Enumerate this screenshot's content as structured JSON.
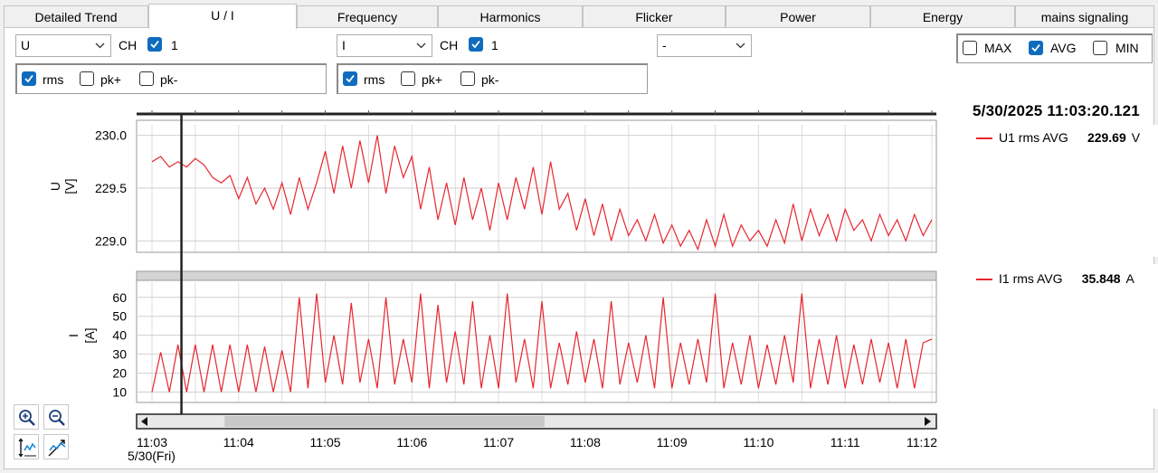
{
  "tabs": [
    {
      "label": "Detailed Trend",
      "active": false
    },
    {
      "label": "U / I",
      "active": true
    },
    {
      "label": "Frequency",
      "active": false
    },
    {
      "label": "Harmonics",
      "active": false
    },
    {
      "label": "Flicker",
      "active": false
    },
    {
      "label": "Power",
      "active": false
    },
    {
      "label": "Energy",
      "active": false
    },
    {
      "label": "mains signaling",
      "active": false
    }
  ],
  "controls": {
    "left": {
      "quantity": "U",
      "ch_label": "CH",
      "channel_checked": true,
      "channel": "1",
      "rms_label": "rms",
      "rms_checked": true,
      "pkp_label": "pk+",
      "pkp_checked": false,
      "pkm_label": "pk-",
      "pkm_checked": false
    },
    "right": {
      "quantity": "I",
      "ch_label": "CH",
      "channel_checked": true,
      "channel": "1",
      "rms_label": "rms",
      "rms_checked": true,
      "pkp_label": "pk+",
      "pkp_checked": false,
      "pkm_label": "pk-",
      "pkm_checked": false
    },
    "third": {
      "value": "-"
    },
    "stats": {
      "max_label": "MAX",
      "max_checked": false,
      "avg_label": "AVG",
      "avg_checked": true,
      "min_label": "MIN",
      "min_checked": false
    }
  },
  "cursor": {
    "timestamp": "5/30/2025 11:03:20.121",
    "time": "11:03:20.121"
  },
  "legend": [
    {
      "name": "U1 rms AVG",
      "value": "229.69",
      "unit": "V"
    },
    {
      "name": "I1 rms AVG",
      "value": "35.848",
      "unit": "A"
    }
  ],
  "colors": {
    "series": "#e8252f",
    "cursor": "#222222",
    "accent": "#0f6cbd"
  },
  "icons": [
    "zoom-in-icon",
    "zoom-out-icon",
    "auto-scale-y-icon",
    "auto-scale-xy-icon",
    "scroll-left-icon",
    "scroll-right-icon"
  ],
  "chart_data": [
    {
      "type": "line",
      "ylabel": "U\n[V]",
      "ylabel_lines": [
        "U",
        "[V]"
      ],
      "ylim": [
        228.9,
        230.1
      ],
      "yticks": [
        "229.0",
        "229.5",
        "230.0"
      ],
      "ytick_values": [
        229.0,
        229.5,
        230.0
      ],
      "xlim": [
        "11:03:00",
        "11:12:00"
      ],
      "series": [
        {
          "name": "U1 rms AVG",
          "color": "#e8252f",
          "x_minutes": [
            0,
            0.1,
            0.2,
            0.3,
            0.4,
            0.5,
            0.6,
            0.7,
            0.8,
            0.9,
            1,
            1.1,
            1.2,
            1.3,
            1.4,
            1.5,
            1.6,
            1.7,
            1.8,
            1.9,
            2,
            2.1,
            2.2,
            2.3,
            2.4,
            2.5,
            2.6,
            2.7,
            2.8,
            2.9,
            3,
            3.1,
            3.2,
            3.3,
            3.4,
            3.5,
            3.6,
            3.7,
            3.8,
            3.9,
            4,
            4.1,
            4.2,
            4.3,
            4.4,
            4.5,
            4.6,
            4.7,
            4.8,
            4.9,
            5,
            5.1,
            5.2,
            5.3,
            5.4,
            5.5,
            5.6,
            5.7,
            5.8,
            5.9,
            6,
            6.1,
            6.2,
            6.3,
            6.4,
            6.5,
            6.6,
            6.7,
            6.8,
            6.9,
            7,
            7.1,
            7.2,
            7.3,
            7.4,
            7.5,
            7.6,
            7.7,
            7.8,
            7.9,
            8,
            8.1,
            8.2,
            8.3,
            8.4,
            8.5,
            8.6,
            8.7,
            8.8,
            8.9,
            9
          ],
          "values": [
            229.75,
            229.8,
            229.7,
            229.75,
            229.7,
            229.78,
            229.72,
            229.6,
            229.55,
            229.62,
            229.4,
            229.6,
            229.35,
            229.5,
            229.3,
            229.55,
            229.25,
            229.6,
            229.3,
            229.55,
            229.85,
            229.45,
            229.9,
            229.5,
            229.95,
            229.55,
            230.0,
            229.45,
            229.9,
            229.6,
            229.8,
            229.3,
            229.7,
            229.2,
            229.55,
            229.15,
            229.6,
            229.2,
            229.5,
            229.1,
            229.55,
            229.2,
            229.6,
            229.3,
            229.7,
            229.25,
            229.75,
            229.3,
            229.45,
            229.1,
            229.4,
            229.05,
            229.35,
            229.0,
            229.3,
            229.05,
            229.2,
            229.0,
            229.25,
            228.98,
            229.15,
            228.95,
            229.1,
            228.92,
            229.2,
            228.95,
            229.25,
            228.95,
            229.15,
            229.0,
            229.1,
            228.95,
            229.2,
            228.98,
            229.35,
            229.0,
            229.3,
            229.05,
            229.25,
            229.0,
            229.3,
            229.1,
            229.2,
            229.0,
            229.25,
            229.05,
            229.2,
            229.0,
            229.25,
            229.05,
            229.2
          ]
        }
      ]
    },
    {
      "type": "line",
      "ylabel": "I\n[A]",
      "ylabel_lines": [
        "I",
        "[A]"
      ],
      "ylim": [
        5,
        68
      ],
      "yticks": [
        "10",
        "20",
        "30",
        "40",
        "50",
        "60"
      ],
      "ytick_values": [
        10,
        20,
        30,
        40,
        50,
        60
      ],
      "xlim": [
        "11:03:00",
        "11:12:00"
      ],
      "series": [
        {
          "name": "I1 rms AVG",
          "color": "#e8252f",
          "x_minutes": [
            0,
            0.1,
            0.2,
            0.3,
            0.4,
            0.5,
            0.6,
            0.7,
            0.8,
            0.9,
            1,
            1.1,
            1.2,
            1.3,
            1.4,
            1.5,
            1.6,
            1.7,
            1.8,
            1.9,
            2,
            2.1,
            2.2,
            2.3,
            2.4,
            2.5,
            2.6,
            2.7,
            2.8,
            2.9,
            3,
            3.1,
            3.2,
            3.3,
            3.4,
            3.5,
            3.6,
            3.7,
            3.8,
            3.9,
            4,
            4.1,
            4.2,
            4.3,
            4.4,
            4.5,
            4.6,
            4.7,
            4.8,
            4.9,
            5,
            5.1,
            5.2,
            5.3,
            5.4,
            5.5,
            5.6,
            5.7,
            5.8,
            5.9,
            6,
            6.1,
            6.2,
            6.3,
            6.4,
            6.5,
            6.6,
            6.7,
            6.8,
            6.9,
            7,
            7.1,
            7.2,
            7.3,
            7.4,
            7.5,
            7.6,
            7.7,
            7.8,
            7.9,
            8,
            8.1,
            8.2,
            8.3,
            8.4,
            8.5,
            8.6,
            8.7,
            8.8,
            8.9,
            9
          ],
          "values": [
            10,
            31,
            10,
            35,
            10,
            35,
            10,
            35,
            10,
            35,
            10,
            35,
            10,
            34,
            10,
            32,
            10,
            60,
            12,
            62,
            15,
            40,
            14,
            57,
            15,
            38,
            12,
            60,
            14,
            38,
            15,
            62,
            12,
            56,
            15,
            42,
            14,
            58,
            12,
            40,
            12,
            62,
            15,
            38,
            12,
            58,
            12,
            36,
            14,
            42,
            15,
            38,
            12,
            58,
            14,
            36,
            15,
            40,
            12,
            60,
            12,
            36,
            14,
            38,
            15,
            62,
            12,
            36,
            14,
            40,
            12,
            35,
            14,
            40,
            15,
            62,
            12,
            38,
            14,
            40,
            12,
            35,
            14,
            38,
            15,
            36,
            12,
            38,
            12,
            36,
            38
          ]
        }
      ]
    }
  ],
  "x_axis": {
    "ticks": [
      "11:03",
      "11:04",
      "11:05",
      "11:06",
      "11:07",
      "11:08",
      "11:09",
      "11:10",
      "11:11",
      "11:12"
    ],
    "date_label": "5/30(Fri)",
    "cursor_minutes": 0.34,
    "scroll_view_fraction": [
      0.11,
      0.51
    ]
  }
}
